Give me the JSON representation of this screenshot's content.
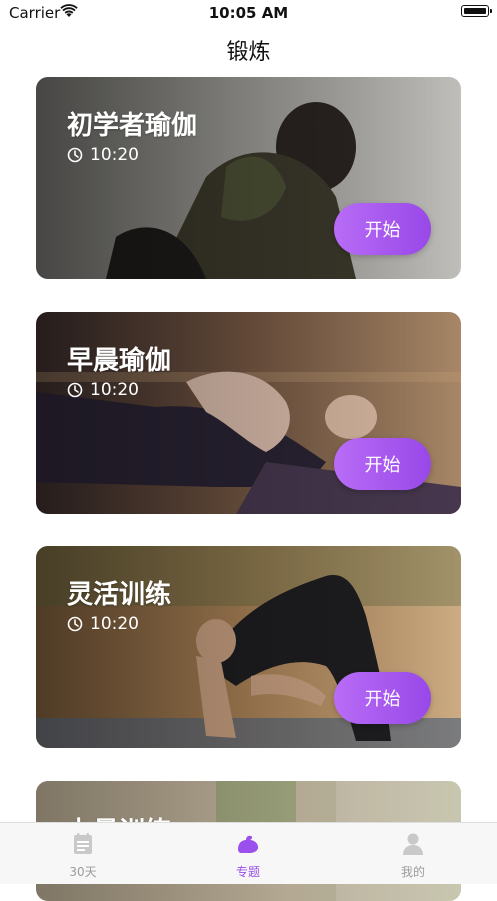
{
  "status_bar": {
    "carrier": "Carrier",
    "time": "10:05 AM"
  },
  "nav": {
    "title": "锻炼"
  },
  "cards": [
    {
      "title": "初学者瑜伽",
      "duration": "10:20",
      "button": "开始"
    },
    {
      "title": "早晨瑜伽",
      "duration": "10:20",
      "button": "开始"
    },
    {
      "title": "灵活训练",
      "duration": "10:20",
      "button": "开始"
    },
    {
      "title": "力量训练"
    }
  ],
  "tab_bar": {
    "items": [
      {
        "label": "30天",
        "icon": "calendar-icon",
        "active": false
      },
      {
        "label": "专题",
        "icon": "muscle-icon",
        "active": true
      },
      {
        "label": "我的",
        "icon": "person-icon",
        "active": false
      }
    ],
    "active_color": "#9b4fec",
    "inactive_color": "#9b9b9b"
  },
  "colors": {
    "button_gradient_start": "#b86cf6",
    "button_gradient_end": "#9848e8"
  }
}
